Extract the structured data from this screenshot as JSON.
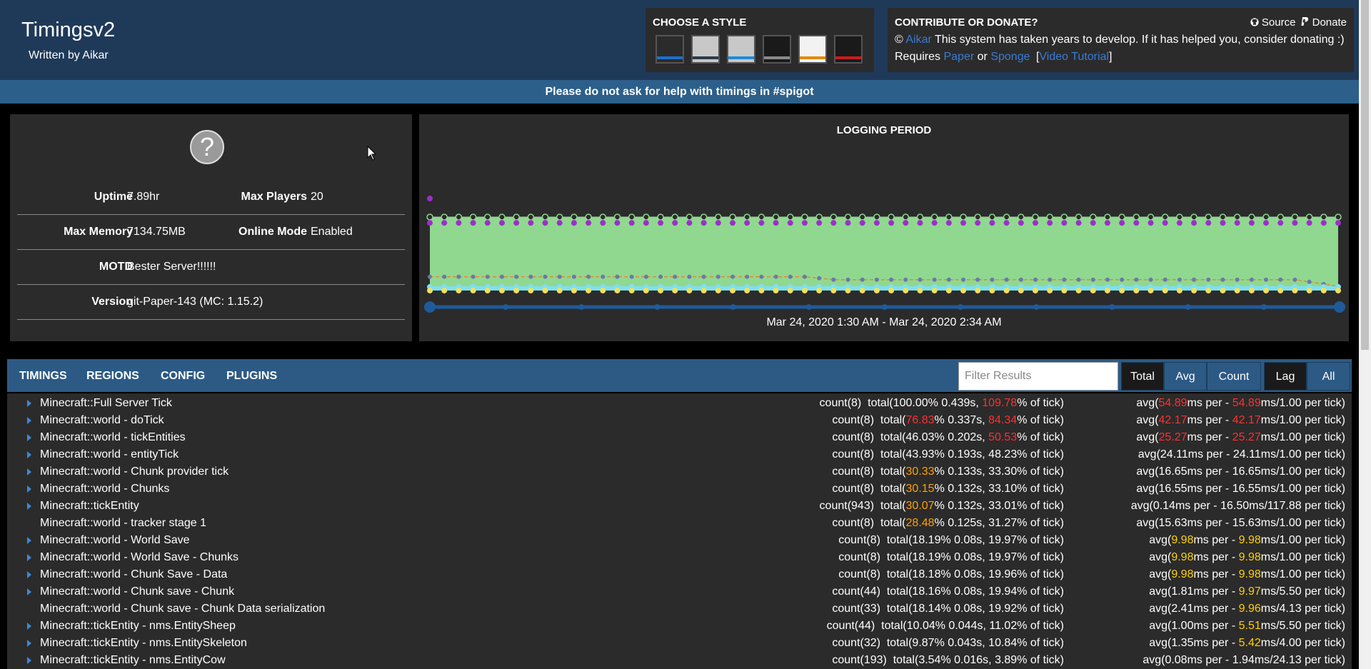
{
  "brand": {
    "title": "Timingsv2",
    "subtitle": "Written by Aikar"
  },
  "style_chooser": {
    "title": "CHOOSE A STYLE",
    "swatches": [
      {
        "name": "dark-blue",
        "bg": "#2b2b2b",
        "bar": "#1f6fd1"
      },
      {
        "name": "light-dark",
        "bg": "#c8c8c8",
        "bar": "#2b3a4a"
      },
      {
        "name": "light-blue",
        "bg": "#c8c8c8",
        "bar": "#1f8ad8"
      },
      {
        "name": "dark-gray",
        "bg": "#1a1a1a",
        "bar": "#8a8a8a"
      },
      {
        "name": "light-orange",
        "bg": "#f2f2f2",
        "bar": "#e08a00"
      },
      {
        "name": "dark-red",
        "bg": "#1a1a1a",
        "bar": "#c81e1e"
      }
    ]
  },
  "contribute": {
    "title": "CONTRIBUTE OR DONATE?",
    "source_label": "Source",
    "donate_label": "Donate",
    "copyright": "©",
    "author_link": "Aikar",
    "line1_text": "This system has taken years to develop. If it has helped you, consider donating :)",
    "requires": "Requires",
    "paper_link": "Paper",
    "or": "or",
    "sponge_link": "Sponge",
    "bracket_open": "[",
    "video_link": "Video Tutorial",
    "bracket_close": "]"
  },
  "notice": "Please do not ask for help with timings in #spigot",
  "server_info": {
    "icon_glyph": "?",
    "uptime_label": "Uptime",
    "uptime": "7.89hr",
    "max_players_label": "Max Players",
    "max_players": "20",
    "max_memory_label": "Max Memory",
    "max_memory": "7134.75MB",
    "online_mode_label": "Online Mode",
    "online_mode": "Enabled",
    "motd_label": "MOTD",
    "motd": "Bester Server!!!!!!",
    "version_label": "Version",
    "version": "git-Paper-143 (MC: 1.15.2)"
  },
  "chart_data": {
    "type": "area",
    "title": "LOGGING PERIOD",
    "range_label": "Mar 24, 2020 1:30 AM - Mar 24, 2020 2:34 AM",
    "colors": {
      "green": "#90d890",
      "purple": "#9b30c8",
      "orange": "#e08a30",
      "cyan": "#80e0f0",
      "yellow": "#f0e060",
      "axis": "#1f5a9a"
    },
    "points": 64,
    "series": [
      {
        "color_key": "green",
        "values_const": 100
      },
      {
        "color_key": "purple",
        "values_const": 92
      },
      {
        "color_key": "orange",
        "start": 18,
        "end": 14
      },
      {
        "color_key": "cyan",
        "values_const": 4
      },
      {
        "color_key": "yellow",
        "values_const": 1
      }
    ]
  },
  "tabs": {
    "timings": "TIMINGS",
    "regions": "REGIONS",
    "config": "CONFIG",
    "plugins": "PLUGINS",
    "filter_placeholder": "Filter Results",
    "total": "Total",
    "avg": "Avg",
    "count": "Count",
    "lag": "Lag",
    "all": "All"
  },
  "timings": [
    {
      "name": "Minecraft::Full Server Tick",
      "expand": true,
      "count": "count(8)",
      "t_pre": "total(",
      "t_pct": "100.00%",
      "t_pct_c": "",
      "t_mid": " 0.439s, ",
      "t_tick": "109.78",
      "t_tick_c": "hi-red",
      "t_post": "% of tick)",
      "a_pre": "avg(",
      "a1": "54.89",
      "a1_c": "hi-red",
      "a_mid": "ms per - ",
      "a2": "54.89",
      "a2_c": "hi-red",
      "a_post": "ms/1.00 per tick)"
    },
    {
      "name": "Minecraft::world - doTick",
      "expand": true,
      "count": "count(8)",
      "t_pre": "total(",
      "t_pct": "76.83",
      "t_pct_c": "hi-red",
      "t_mid": "% 0.337s, ",
      "t_tick": "84.34",
      "t_tick_c": "hi-red",
      "t_post": "% of tick)",
      "a_pre": "avg(",
      "a1": "42.17",
      "a1_c": "hi-red",
      "a_mid": "ms per - ",
      "a2": "42.17",
      "a2_c": "hi-red",
      "a_post": "ms/1.00 per tick)"
    },
    {
      "name": "Minecraft::world - tickEntities",
      "expand": true,
      "count": "count(8)",
      "t_pre": "total(",
      "t_pct": "46.03%",
      "t_pct_c": "",
      "t_mid": " 0.202s, ",
      "t_tick": "50.53",
      "t_tick_c": "hi-red",
      "t_post": "% of tick)",
      "a_pre": "avg(",
      "a1": "25.27",
      "a1_c": "hi-red",
      "a_mid": "ms per - ",
      "a2": "25.27",
      "a2_c": "hi-red",
      "a_post": "ms/1.00 per tick)"
    },
    {
      "name": "Minecraft::world - entityTick",
      "expand": true,
      "count": "count(8)",
      "t_pre": "total(",
      "t_pct": "43.93%",
      "t_pct_c": "",
      "t_mid": " 0.193s, ",
      "t_tick": "48.23%",
      "t_tick_c": "",
      "t_post": " of tick)",
      "a_pre": "avg(",
      "a1": "24.11",
      "a1_c": "",
      "a_mid": "ms per - ",
      "a2": "24.11",
      "a2_c": "",
      "a_post": "ms/1.00 per tick)"
    },
    {
      "name": "Minecraft::world - Chunk provider tick",
      "expand": true,
      "count": "count(8)",
      "t_pre": "total(",
      "t_pct": "30.33",
      "t_pct_c": "hi-orange",
      "t_mid": "% 0.133s, ",
      "t_tick": "33.30%",
      "t_tick_c": "",
      "t_post": " of tick)",
      "a_pre": "avg(",
      "a1": "16.65",
      "a1_c": "",
      "a_mid": "ms per - ",
      "a2": "16.65",
      "a2_c": "",
      "a_post": "ms/1.00 per tick)"
    },
    {
      "name": "Minecraft::world - Chunks",
      "expand": true,
      "count": "count(8)",
      "t_pre": "total(",
      "t_pct": "30.15",
      "t_pct_c": "hi-orange",
      "t_mid": "% 0.132s, ",
      "t_tick": "33.10%",
      "t_tick_c": "",
      "t_post": " of tick)",
      "a_pre": "avg(",
      "a1": "16.55",
      "a1_c": "",
      "a_mid": "ms per - ",
      "a2": "16.55",
      "a2_c": "",
      "a_post": "ms/1.00 per tick)"
    },
    {
      "name": "Minecraft::tickEntity",
      "expand": true,
      "count": "count(943)",
      "t_pre": "total(",
      "t_pct": "30.07",
      "t_pct_c": "hi-orange",
      "t_mid": "% 0.132s, ",
      "t_tick": "33.01%",
      "t_tick_c": "",
      "t_post": " of tick)",
      "a_pre": "avg(",
      "a1": "0.14",
      "a1_c": "",
      "a_mid": "ms per - ",
      "a2": "16.50",
      "a2_c": "",
      "a_post": "ms/117.88 per tick)"
    },
    {
      "name": "Minecraft::world - tracker stage 1",
      "expand": false,
      "count": "count(8)",
      "t_pre": "total(",
      "t_pct": "28.48",
      "t_pct_c": "hi-orange",
      "t_mid": "% 0.125s, ",
      "t_tick": "31.27%",
      "t_tick_c": "",
      "t_post": " of tick)",
      "a_pre": "avg(",
      "a1": "15.63",
      "a1_c": "",
      "a_mid": "ms per - ",
      "a2": "15.63",
      "a2_c": "",
      "a_post": "ms/1.00 per tick)"
    },
    {
      "name": "Minecraft::world - World Save",
      "expand": true,
      "count": "count(8)",
      "t_pre": "total(",
      "t_pct": "18.19%",
      "t_pct_c": "",
      "t_mid": " 0.08s, ",
      "t_tick": "19.97%",
      "t_tick_c": "",
      "t_post": " of tick)",
      "a_pre": "avg(",
      "a1": "9.98",
      "a1_c": "hi-yellow",
      "a_mid": "ms per - ",
      "a2": "9.98",
      "a2_c": "hi-yellow",
      "a_post": "ms/1.00 per tick)"
    },
    {
      "name": "Minecraft::world - World Save - Chunks",
      "expand": true,
      "count": "count(8)",
      "t_pre": "total(",
      "t_pct": "18.19%",
      "t_pct_c": "",
      "t_mid": " 0.08s, ",
      "t_tick": "19.97%",
      "t_tick_c": "",
      "t_post": " of tick)",
      "a_pre": "avg(",
      "a1": "9.98",
      "a1_c": "hi-yellow",
      "a_mid": "ms per - ",
      "a2": "9.98",
      "a2_c": "hi-yellow",
      "a_post": "ms/1.00 per tick)"
    },
    {
      "name": "Minecraft::world - Chunk Save - Data",
      "expand": true,
      "count": "count(8)",
      "t_pre": "total(",
      "t_pct": "18.18%",
      "t_pct_c": "",
      "t_mid": " 0.08s, ",
      "t_tick": "19.96%",
      "t_tick_c": "",
      "t_post": " of tick)",
      "a_pre": "avg(",
      "a1": "9.98",
      "a1_c": "hi-yellow",
      "a_mid": "ms per - ",
      "a2": "9.98",
      "a2_c": "hi-yellow",
      "a_post": "ms/1.00 per tick)"
    },
    {
      "name": "Minecraft::world - Chunk save - Chunk",
      "expand": true,
      "count": "count(44)",
      "t_pre": "total(",
      "t_pct": "18.16%",
      "t_pct_c": "",
      "t_mid": " 0.08s, ",
      "t_tick": "19.94%",
      "t_tick_c": "",
      "t_post": " of tick)",
      "a_pre": "avg(",
      "a1": "1.81",
      "a1_c": "",
      "a_mid": "ms per - ",
      "a2": "9.97",
      "a2_c": "hi-yellow",
      "a_post": "ms/5.50 per tick)"
    },
    {
      "name": "Minecraft::world - Chunk save - Chunk Data serialization",
      "expand": false,
      "count": "count(33)",
      "t_pre": "total(",
      "t_pct": "18.14%",
      "t_pct_c": "",
      "t_mid": " 0.08s, ",
      "t_tick": "19.92%",
      "t_tick_c": "",
      "t_post": " of tick)",
      "a_pre": "avg(",
      "a1": "2.41",
      "a1_c": "",
      "a_mid": "ms per - ",
      "a2": "9.96",
      "a2_c": "hi-yellow",
      "a_post": "ms/4.13 per tick)"
    },
    {
      "name": "Minecraft::tickEntity - nms.EntitySheep",
      "expand": true,
      "count": "count(44)",
      "t_pre": "total(",
      "t_pct": "10.04%",
      "t_pct_c": "",
      "t_mid": " 0.044s, ",
      "t_tick": "11.02%",
      "t_tick_c": "",
      "t_post": " of tick)",
      "a_pre": "avg(",
      "a1": "1.00",
      "a1_c": "",
      "a_mid": "ms per - ",
      "a2": "5.51",
      "a2_c": "hi-yellow",
      "a_post": "ms/5.50 per tick)"
    },
    {
      "name": "Minecraft::tickEntity - nms.EntitySkeleton",
      "expand": true,
      "count": "count(32)",
      "t_pre": "total(",
      "t_pct": "9.87%",
      "t_pct_c": "",
      "t_mid": " 0.043s, ",
      "t_tick": "10.84%",
      "t_tick_c": "",
      "t_post": " of tick)",
      "a_pre": "avg(",
      "a1": "1.35",
      "a1_c": "",
      "a_mid": "ms per - ",
      "a2": "5.42",
      "a2_c": "hi-yellow",
      "a_post": "ms/4.00 per tick)"
    },
    {
      "name": "Minecraft::tickEntity - nms.EntityCow",
      "expand": true,
      "count": "count(193)",
      "t_pre": "total(",
      "t_pct": "3.54%",
      "t_pct_c": "",
      "t_mid": " 0.016s, ",
      "t_tick": "3.89%",
      "t_tick_c": "",
      "t_post": " of tick)",
      "a_pre": "avg(",
      "a1": "0.08",
      "a1_c": "",
      "a_mid": "ms per - ",
      "a2": "1.94",
      "a2_c": "",
      "a_post": "ms/24.13 per tick)"
    }
  ]
}
